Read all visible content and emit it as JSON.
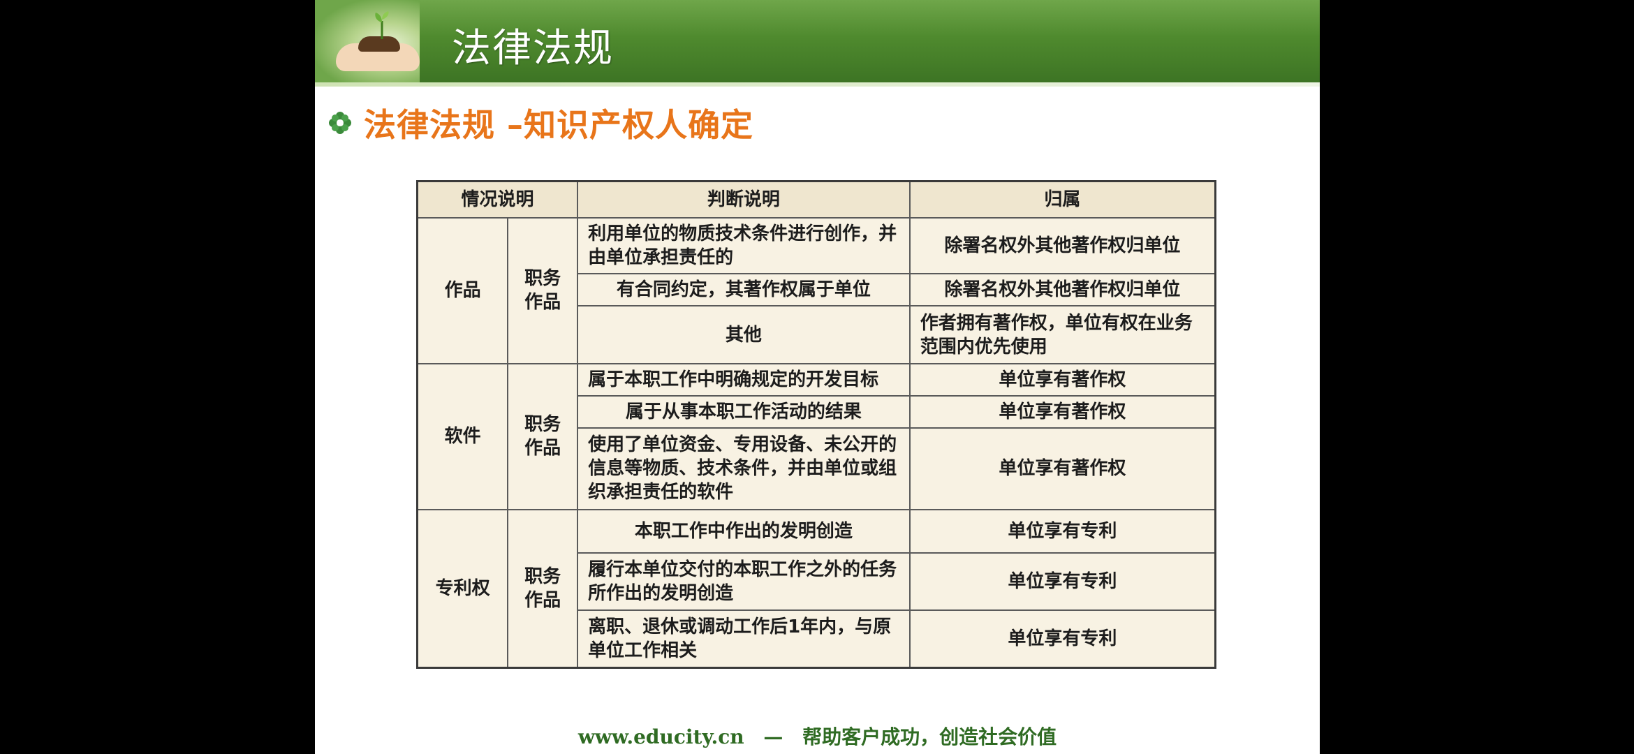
{
  "slide": {
    "banner_title": "法律法规",
    "heading": "法律法规 –知识产权人确定",
    "footer_url": "www.educity.cn",
    "footer_dash": "—",
    "footer_slogan": "帮助客户成功，创造社会价值"
  },
  "table": {
    "headers": [
      "情况说明",
      "判断说明",
      "归属"
    ],
    "groups": [
      {
        "category": "作品",
        "subcategory": "职务作品",
        "rows": [
          {
            "judgement": "利用单位的物质技术条件进行创作，并由单位承担责任的",
            "ownership": "除署名权外其他著作权归单位"
          },
          {
            "judgement": "有合同约定，其著作权属于单位",
            "ownership": "除署名权外其他著作权归单位"
          },
          {
            "judgement": "其他",
            "ownership": "作者拥有著作权，单位有权在业务范围内优先使用"
          }
        ]
      },
      {
        "category": "软件",
        "subcategory": "职务作品",
        "rows": [
          {
            "judgement": "属于本职工作中明确规定的开发目标",
            "ownership": "单位享有著作权"
          },
          {
            "judgement": "属于从事本职工作活动的结果",
            "ownership": "单位享有著作权"
          },
          {
            "judgement": "使用了单位资金、专用设备、未公开的信息等物质、技术条件，并由单位或组织承担责任的软件",
            "ownership": "单位享有著作权"
          }
        ]
      },
      {
        "category": "专利权",
        "subcategory": "职务作品",
        "rows": [
          {
            "judgement": "本职工作中作出的发明创造",
            "ownership": "单位享有专利"
          },
          {
            "judgement": "履行本单位交付的本职工作之外的任务所作出的发明创造",
            "ownership": "单位享有专利"
          },
          {
            "judgement": "离职、退休或调动工作后1年内，与原单位工作相关",
            "ownership": "单位享有专利"
          }
        ]
      }
    ]
  },
  "colors": {
    "banner_green": "#4f8a2e",
    "heading_orange": "#e8751a",
    "table_bg": "#f8f2e3",
    "footer_green": "#2f6b23"
  },
  "icons": {
    "bullet": "flower-bullet-icon",
    "banner_art": "sprout-in-hand-icon"
  }
}
